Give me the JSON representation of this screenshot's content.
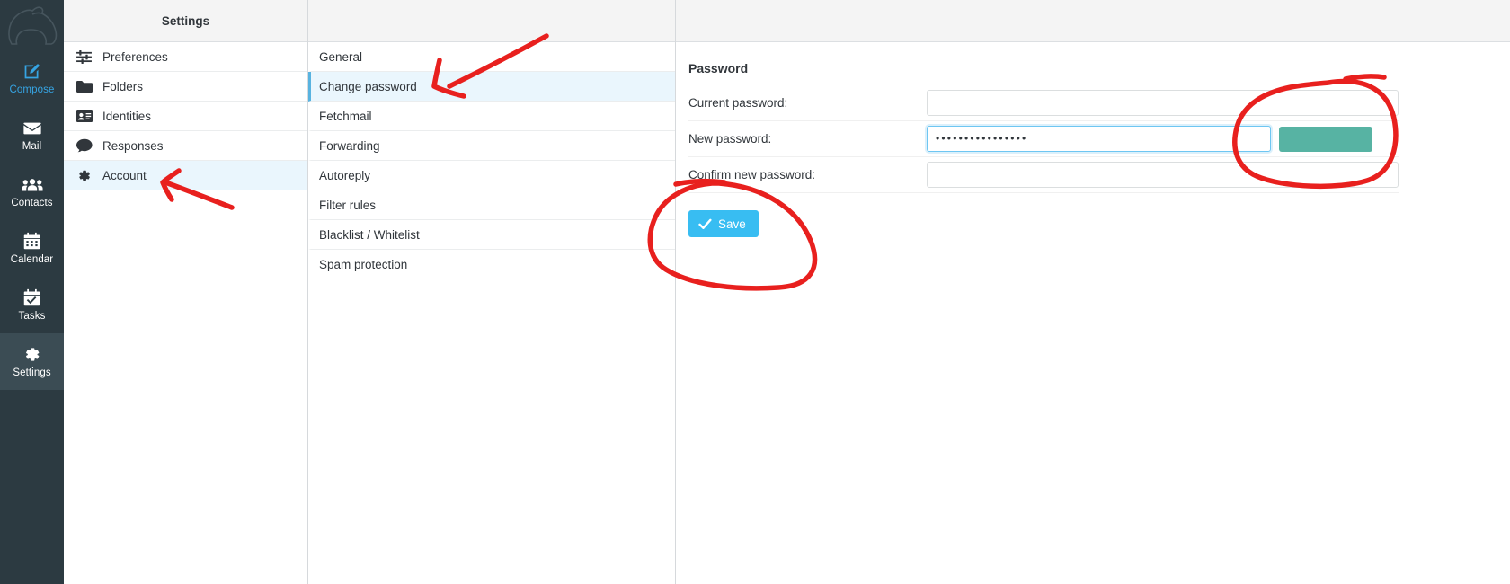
{
  "taskbar": {
    "logo_icon": "polar-bear-logo",
    "items": [
      {
        "label": "Compose",
        "icon": "compose-icon",
        "state": "accent"
      },
      {
        "label": "Mail",
        "icon": "envelope-icon",
        "state": "normal"
      },
      {
        "label": "Contacts",
        "icon": "people-icon",
        "state": "normal"
      },
      {
        "label": "Calendar",
        "icon": "calendar-icon",
        "state": "normal"
      },
      {
        "label": "Tasks",
        "icon": "tasks-icon",
        "state": "normal"
      },
      {
        "label": "Settings",
        "icon": "gear-icon",
        "state": "selected"
      }
    ]
  },
  "settings_column": {
    "header": "Settings",
    "items": [
      {
        "label": "Preferences",
        "icon": "sliders-icon",
        "selected": false
      },
      {
        "label": "Folders",
        "icon": "folder-icon",
        "selected": false
      },
      {
        "label": "Identities",
        "icon": "id-card-icon",
        "selected": false
      },
      {
        "label": "Responses",
        "icon": "comment-icon",
        "selected": false
      },
      {
        "label": "Account",
        "icon": "gear-icon",
        "selected": true
      }
    ]
  },
  "sections_column": {
    "header": "",
    "items": [
      {
        "label": "General",
        "selected": false
      },
      {
        "label": "Change password",
        "selected": true
      },
      {
        "label": "Fetchmail",
        "selected": false
      },
      {
        "label": "Forwarding",
        "selected": false
      },
      {
        "label": "Autoreply",
        "selected": false
      },
      {
        "label": "Filter rules",
        "selected": false
      },
      {
        "label": "Blacklist / Whitelist",
        "selected": false
      },
      {
        "label": "Spam protection",
        "selected": false
      }
    ]
  },
  "form": {
    "title": "Password",
    "rows": [
      {
        "label": "Current password:",
        "value": "",
        "placeholder": "",
        "focused": false,
        "has_meter": false
      },
      {
        "label": "New password:",
        "value": "••••••••••••••••",
        "placeholder": "",
        "focused": true,
        "has_meter": true
      },
      {
        "label": "Confirm new password:",
        "value": "",
        "placeholder": "",
        "focused": false,
        "has_meter": false
      }
    ],
    "save_label": "Save",
    "save_icon": "check-icon"
  },
  "colors": {
    "taskbar_bg": "#2c3a41",
    "taskbar_selected": "#3b4c54",
    "accent_blue": "#36a4e3",
    "button_blue": "#38bdf2",
    "selected_row": "#eaf6fd",
    "selection_bar": "#58b3e0",
    "strength_meter": "#57b3a3",
    "annotation_red": "#e8201e"
  },
  "annotations": {
    "items": [
      {
        "name": "arrow-to-change-password",
        "shape": "arrow"
      },
      {
        "name": "arrow-to-account",
        "shape": "arrow"
      },
      {
        "name": "circle-around-strength-meter",
        "shape": "ellipse"
      },
      {
        "name": "circle-around-save-button",
        "shape": "ellipse"
      }
    ]
  }
}
